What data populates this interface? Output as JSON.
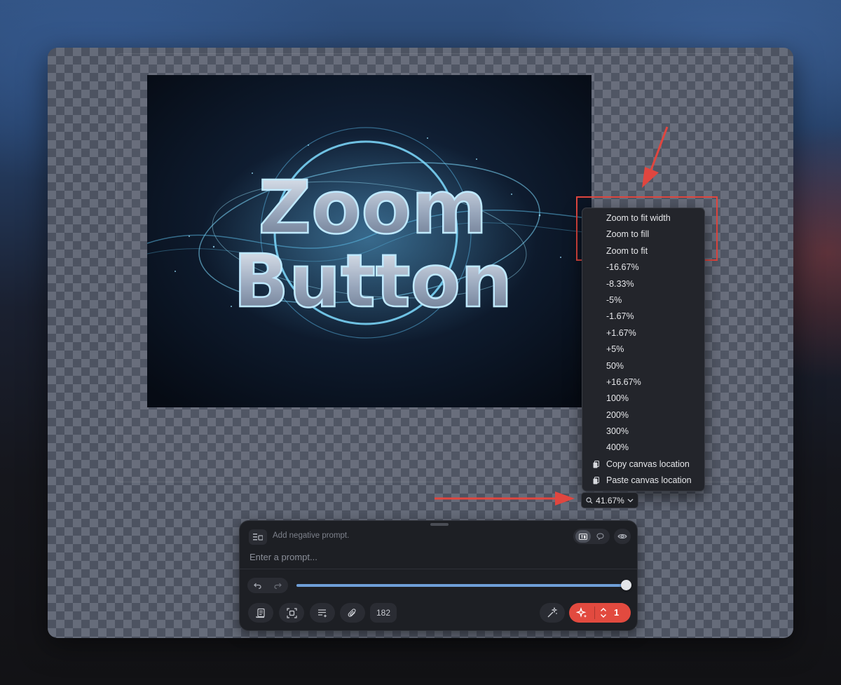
{
  "canvas": {
    "artwork_text": [
      "Zoom",
      "Button"
    ]
  },
  "zoom_menu": {
    "items": [
      {
        "label": "Zoom to fit width",
        "icon": null
      },
      {
        "label": "Zoom to fill",
        "icon": null
      },
      {
        "label": "Zoom to fit",
        "icon": null
      },
      {
        "label": "-16.67%",
        "icon": null
      },
      {
        "label": "-8.33%",
        "icon": null
      },
      {
        "label": "-5%",
        "icon": null
      },
      {
        "label": "-1.67%",
        "icon": null
      },
      {
        "label": "+1.67%",
        "icon": null
      },
      {
        "label": "+5%",
        "icon": null
      },
      {
        "label": "50%",
        "icon": null
      },
      {
        "label": "+16.67%",
        "icon": null
      },
      {
        "label": "100%",
        "icon": null
      },
      {
        "label": "200%",
        "icon": null
      },
      {
        "label": "300%",
        "icon": null
      },
      {
        "label": "400%",
        "icon": null
      },
      {
        "label": "Copy canvas location",
        "icon": "copy-icon"
      },
      {
        "label": "Paste canvas location",
        "icon": "paste-icon"
      }
    ]
  },
  "zoom_button": {
    "label": "41.67%",
    "icon": "search-icon"
  },
  "prompt_panel": {
    "negative_prompt_label": "Add negative prompt.",
    "prompt_placeholder": "Enter a prompt...",
    "prompt_value": "",
    "slider_fraction": 1.0,
    "count_label": "182",
    "generate_count": "1"
  },
  "colors": {
    "accent_red": "#e24a3f",
    "annotation_red": "#e0463f",
    "slider_blue": "#6f9fd8"
  }
}
